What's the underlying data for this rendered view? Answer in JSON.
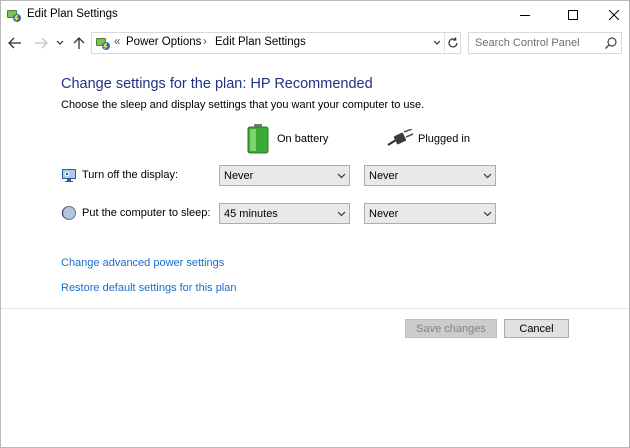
{
  "window": {
    "title": "Edit Plan Settings"
  },
  "address": {
    "sep": "«",
    "crumbs": [
      "Power Options",
      "Edit Plan Settings"
    ],
    "crumb_sep": "›"
  },
  "search": {
    "placeholder": "Search Control Panel"
  },
  "main": {
    "heading": "Change settings for the plan: HP Recommended",
    "subtitle": "Choose the sleep and display settings that you want your computer to use.",
    "columns": {
      "battery": "On battery",
      "plugged": "Plugged in"
    },
    "rows": [
      {
        "label": "Turn off the display:",
        "battery": "Never",
        "plugged": "Never"
      },
      {
        "label": "Put the computer to sleep:",
        "battery": "45 minutes",
        "plugged": "Never"
      }
    ],
    "links": {
      "advanced": "Change advanced power settings",
      "restore": "Restore default settings for this plan"
    }
  },
  "buttons": {
    "save": "Save changes",
    "cancel": "Cancel"
  },
  "colors": {
    "heading": "#1e3287",
    "link": "#1a6ccf",
    "battery_green": "#3aa935"
  },
  "icons": {
    "app": "power-plan-icon",
    "back": "arrow-left-icon",
    "forward": "arrow-right-icon",
    "recent": "chevron-down-icon",
    "up": "arrow-up-icon",
    "refresh": "refresh-icon",
    "search": "search-icon",
    "battery": "battery-icon",
    "plug": "plug-icon",
    "display": "monitor-icon",
    "sleep": "moon-icon"
  }
}
